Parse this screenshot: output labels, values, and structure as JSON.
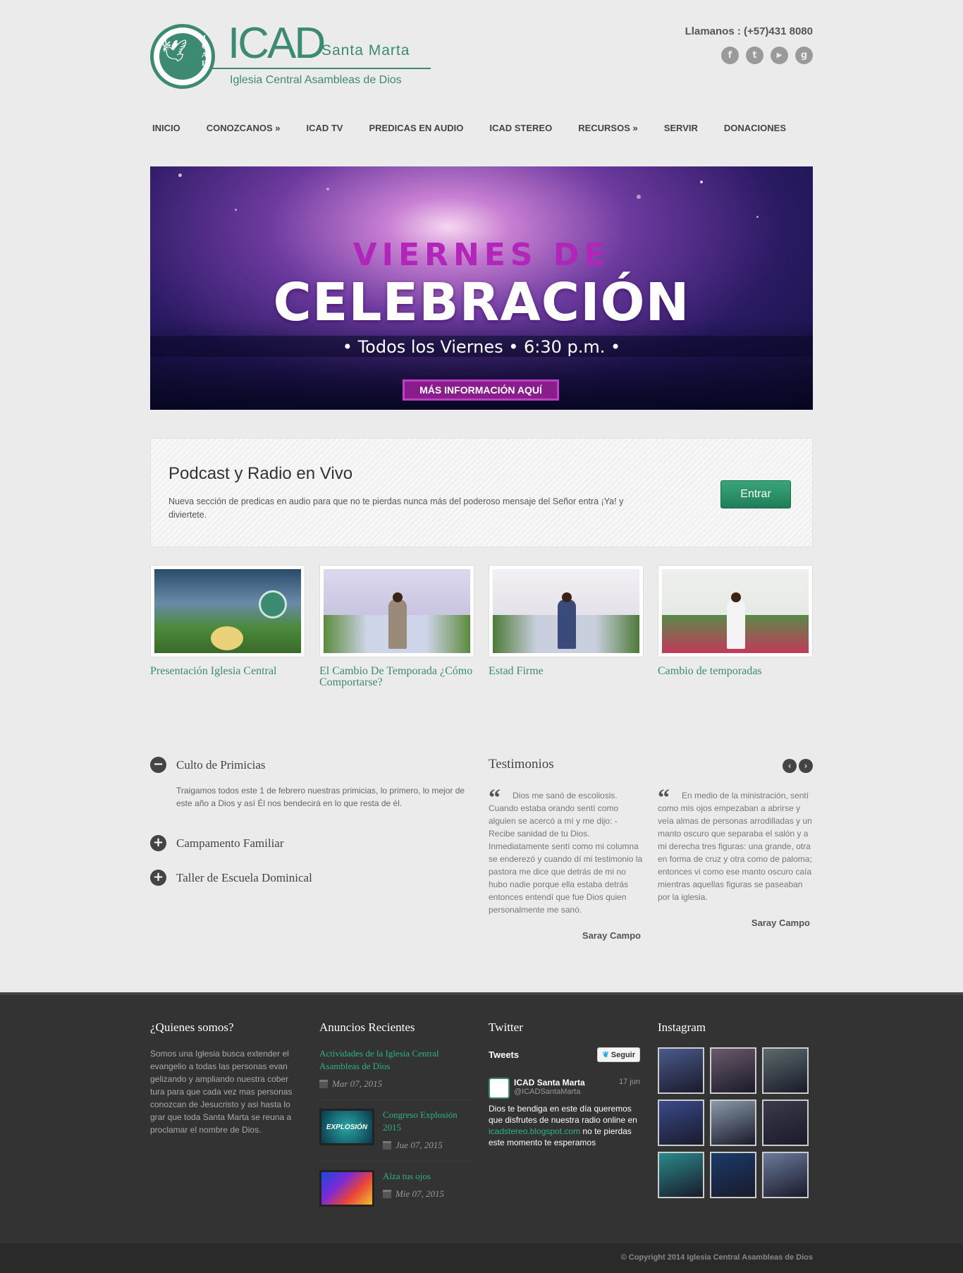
{
  "header": {
    "logo_big": "ICAD",
    "logo_city": "Santa Marta",
    "logo_sub": "Iglesia Central Asambleas de Dios",
    "logo_badge": "ICAD",
    "phone": "Llamanos : (+57)431 8080",
    "socials": [
      {
        "icon": "facebook-icon",
        "glyph": "f"
      },
      {
        "icon": "twitter-icon",
        "glyph": "t"
      },
      {
        "icon": "youtube-icon",
        "glyph": "▶"
      },
      {
        "icon": "google-plus-icon",
        "glyph": "g"
      }
    ]
  },
  "nav": [
    "INICIO",
    "CONOZCANOS »",
    "ICAD TV",
    "PREDICAS EN AUDIO",
    "ICAD STEREO",
    "RECURSOS »",
    "SERVIR",
    "DONACIONES"
  ],
  "slider": {
    "line1": "VIERNES DE",
    "line2": "CELEBRACIÓN",
    "line3": "• Todos los Viernes • 6:30 p.m. •",
    "button": "MÁS INFORMACIÓN AQUÍ"
  },
  "podcast": {
    "title": "Podcast y Radio en Vivo",
    "text": "Nueva sección de predicas en audio para que no te pierdas nunca más del poderoso mensaje del Señor entra ¡Ya! y diviertete.",
    "button": "Entrar"
  },
  "videos": [
    {
      "title": "Presentación Iglesia Central"
    },
    {
      "title": "El Cambio De Temporada ¿Cómo Comportarse?"
    },
    {
      "title": "Estad Firme"
    },
    {
      "title": "Cambio de temporadas"
    }
  ],
  "accordion": [
    {
      "title": "Culto de Primicias",
      "expanded": true,
      "icon": "−",
      "body": "Traigamos todos este 1 de febrero nuestras primicias, lo primero, lo mejor de este año a Dios y así Él nos bendecirá en lo que resta de él."
    },
    {
      "title": "Campamento Familiar",
      "expanded": false,
      "icon": "+"
    },
    {
      "title": "Taller de Escuela Dominical",
      "expanded": false,
      "icon": "+"
    }
  ],
  "testimonials": {
    "title": "Testimonios",
    "prev": "‹",
    "next": "›",
    "quote_mark": "“",
    "items": [
      {
        "text": "Dios me sanó de escoliosis. Cuando estaba orando sentí como alguien se acercó a mí y me dijo: - Recibe sanidad de tu Dios. Inmediatamente sentí como mi columna se enderezó y cuando dí mi testimonio la pastora me dice que detrás de mi no hubo nadie porque ella estaba detrás entonces entendí que fue Dios quien personalmente me sanó.",
        "author": "Saray Campo"
      },
      {
        "text": "En medio de la ministración, sentí como mis ojos empezaban a abrirse y veía almas de personas arrodilladas y un manto oscuro que separaba el salón y a mi derecha tres figuras: una grande, otra en forma de cruz y otra como de paloma; entonces vi como ese manto oscuro caía mientras aquellas figuras se paseaban por la iglesia.",
        "author": "Saray Campo"
      }
    ]
  },
  "footer": {
    "about": {
      "title": "¿Quienes somos?",
      "text": "Somos una Iglesia busca extender el evangelio a todas las personas evan gelizando y ampliando nuestra cober tura para que cada vez mas personas conozcan de Jesucristo y asi hasta lo grar que toda Santa Marta se reuna a proclamar el nombre de Dios."
    },
    "announcements": {
      "title": "Anuncios Recientes",
      "items": [
        {
          "title": "Actividades de la Iglesia Central Asambleas de Dios",
          "date": "Mar 07, 2015",
          "has_thumb": false
        },
        {
          "title": "Congreso Explosión 2015",
          "date": "Jue 07, 2015",
          "has_thumb": true,
          "thumb_text": "EXPLOSIÓN"
        },
        {
          "title": "Alza tus ojos",
          "date": "Mie 07, 2015",
          "has_thumb": true,
          "thumb_text": ""
        }
      ]
    },
    "twitter": {
      "title": "Twitter",
      "label": "Tweets",
      "follow": "Seguir",
      "tweet": {
        "name": "ICAD Santa Marta",
        "handle": "@ICADSantaMarta",
        "date": "17 jun",
        "text_before": "Dios te bendiga en este día queremos que disfrutes de nuestra radio online en ",
        "link": "icadstereo.blogspot.com",
        "text_after": " no te pierdas este momento te esperamos"
      }
    },
    "instagram": {
      "title": "Instagram",
      "colors": [
        "#4a5a8a",
        "#6a5a6a",
        "#5a6a6a",
        "#3a4a8a",
        "#8a9aa8",
        "#3a3a4a",
        "#2a8a8a",
        "#1a3a6a",
        "#6a7a9a"
      ]
    }
  },
  "copyright": "© Copyright 2014 Iglesia Central Asambleas de Dios",
  "colors": {
    "brand_green": "#3d8a73",
    "link_green": "#2eb37f",
    "background": "#ebebeb",
    "footer": "#333333"
  }
}
